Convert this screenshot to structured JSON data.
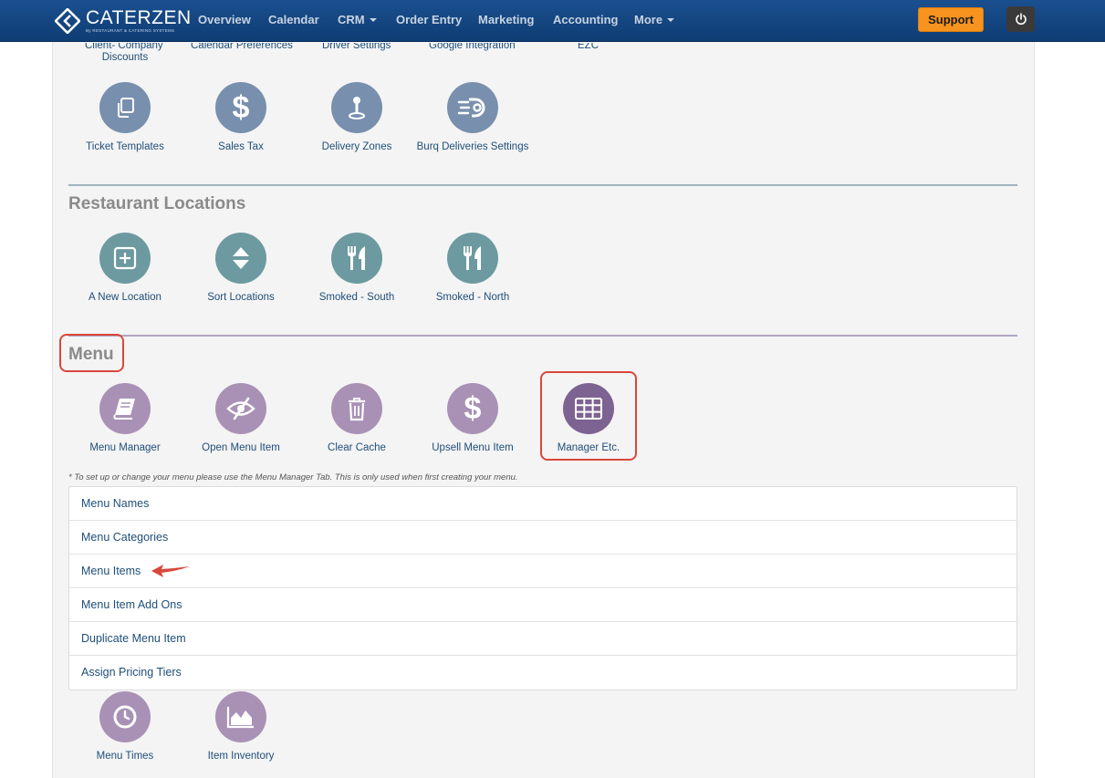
{
  "brand": {
    "name": "CATERZEN",
    "sub": "By RESTAURANT & CATERING SYSTEMS"
  },
  "nav": {
    "items": [
      "Overview",
      "Calendar",
      "CRM",
      "Order Entry",
      "Marketing",
      "Accounting",
      "More"
    ],
    "support_label": "Support"
  },
  "top_partial": {
    "client_discounts_line1": "Client- Company",
    "client_discounts_line2": "Discounts",
    "calendar_prefs": "Calendar Preferences",
    "driver_settings": "Driver Settings",
    "google_integration": "Google Integration",
    "ezc": "EZC"
  },
  "settings_row": [
    {
      "label": "Ticket Templates",
      "icon": "copy-icon"
    },
    {
      "label": "Sales Tax",
      "icon": "dollar-icon"
    },
    {
      "label": "Delivery Zones",
      "icon": "map-pin-icon"
    },
    {
      "label": "Burq Deliveries Settings",
      "icon": "delivery-icon"
    }
  ],
  "restaurant_locations": {
    "title": "Restaurant Locations",
    "tiles": [
      {
        "label": "A New Location",
        "icon": "plus-square-icon"
      },
      {
        "label": "Sort Locations",
        "icon": "sort-icon"
      },
      {
        "label": "Smoked - South",
        "icon": "utensils-icon"
      },
      {
        "label": "Smoked - North",
        "icon": "utensils-icon"
      }
    ]
  },
  "menu": {
    "title": "Menu",
    "tiles": [
      {
        "label": "Menu Manager",
        "icon": "book-icon"
      },
      {
        "label": "Open Menu Item",
        "icon": "eye-slash-icon"
      },
      {
        "label": "Clear Cache",
        "icon": "trash-icon"
      },
      {
        "label": "Upsell Menu Item",
        "icon": "dollar-icon"
      },
      {
        "label": "Manager Etc.",
        "icon": "grid-icon"
      }
    ],
    "note": "* To set up or change your menu please use the Menu Manager Tab. This is only used when first creating your menu.",
    "list": [
      "Menu Names",
      "Menu Categories",
      "Menu Items",
      "Menu Item Add Ons",
      "Duplicate Menu Item",
      "Assign Pricing Tiers"
    ],
    "bottom_tiles": [
      {
        "label": "Menu Times",
        "icon": "clock-icon"
      },
      {
        "label": "Item Inventory",
        "icon": "area-chart-icon"
      }
    ]
  },
  "colors": {
    "nav_bg": "#0f3d74",
    "support": "#f7931e",
    "tile_blue": "#7890ad",
    "tile_teal": "#6c9aa0",
    "tile_purple": "#a991b6",
    "tile_purple_active": "#7d6391",
    "annotation_red": "#d9473b"
  }
}
